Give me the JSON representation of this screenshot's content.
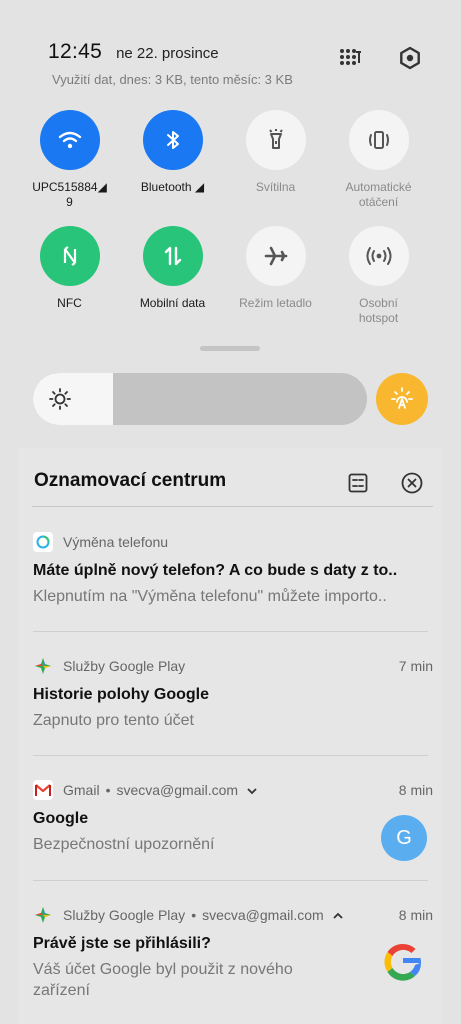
{
  "status": {
    "time": "12:45",
    "date": "ne 22. prosince",
    "data_usage": "Využití dat, dnes: 3 KB, tento měsíc: 3 KB"
  },
  "tiles": [
    {
      "label": "UPC515884◢\n9",
      "icon": "wifi-icon",
      "state": "on"
    },
    {
      "label": "Bluetooth ◢",
      "icon": "bluetooth-icon",
      "state": "on"
    },
    {
      "label": "Svítilna",
      "icon": "flashlight-icon",
      "state": "off"
    },
    {
      "label": "Automatické\notáčení",
      "icon": "auto-rotate-icon",
      "state": "off"
    },
    {
      "label": "NFC",
      "icon": "nfc-icon",
      "state": "on"
    },
    {
      "label": "Mobilní data",
      "icon": "mobile-data-icon",
      "state": "on"
    },
    {
      "label": "Režim letadlo",
      "icon": "airplane-icon",
      "state": "off"
    },
    {
      "label": "Osobní\nhotspot",
      "icon": "hotspot-icon",
      "state": "off"
    }
  ],
  "brightness": {
    "level": 0.24
  },
  "colors": {
    "blue": "#1a78f2",
    "green": "#27c47a",
    "amber": "#f8b72f",
    "avatar_blue": "#5aaef0"
  },
  "notification_center": {
    "title": "Oznamovací centrum",
    "notifications": [
      {
        "app": "Výměna telefonu",
        "time": "",
        "title": "Máte úplně nový telefon? A co bude s daty z to..",
        "text": "Klepnutím na \"Výměna telefonu\" můžete importo.."
      },
      {
        "app": "Služby Google Play",
        "time": "7 min",
        "title": "Historie polohy Google",
        "text": "Zapnuto pro tento účet"
      },
      {
        "app": "Gmail",
        "account": "svecva@gmail.com",
        "time": "8 min",
        "title": "Google",
        "text": "Bezpečnostní upozornění",
        "avatar_letter": "G"
      },
      {
        "app": "Služby Google Play",
        "account": "svecva@gmail.com",
        "time": "8 min",
        "title": "Právě jste se přihlásili?",
        "text": "Váš účet Google byl použit z nového zařízení"
      }
    ]
  }
}
